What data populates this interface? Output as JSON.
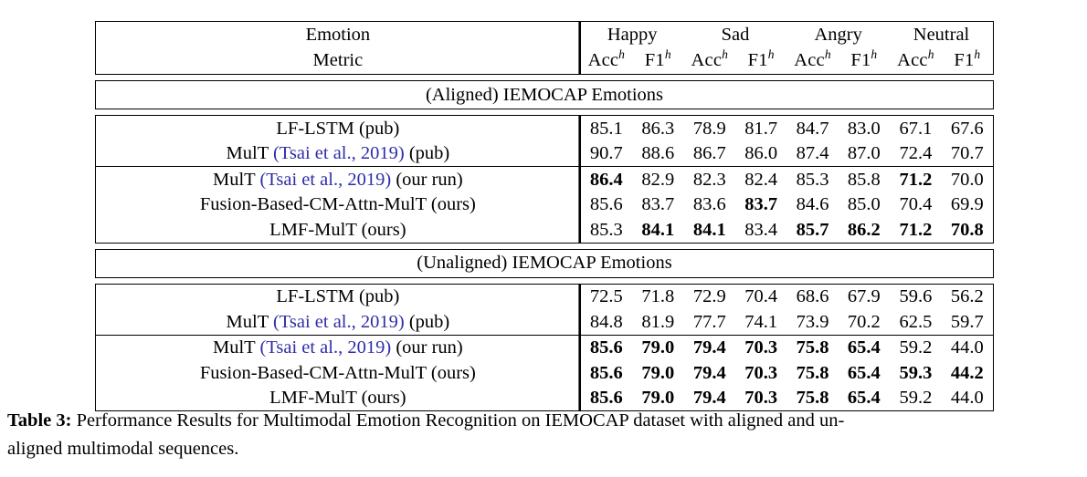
{
  "table": {
    "id_label": "Table 3:",
    "caption_line1": "Performance Results for Multimodal Emotion Recognition on IEMOCAP dataset with aligned and un-",
    "caption_line2": "aligned multimodal sequences.",
    "header": {
      "emotion_label": "Emotion",
      "metric_label": "Metric",
      "emotions": [
        "Happy",
        "Sad",
        "Angry",
        "Neutral"
      ],
      "metrics": [
        "Acc",
        "F1"
      ],
      "metric_superscript": "h"
    },
    "sections": [
      {
        "title": "(Aligned) IEMOCAP Emotions",
        "groups": [
          {
            "rows": [
              {
                "label_parts": [
                  {
                    "text": "LF-LSTM (pub)",
                    "cite": false
                  }
                ],
                "values": [
                  "85.1",
                  "86.3",
                  "78.9",
                  "81.7",
                  "84.7",
                  "83.0",
                  "67.1",
                  "67.6"
                ],
                "bold": [
                  false,
                  false,
                  false,
                  false,
                  false,
                  false,
                  false,
                  false
                ]
              },
              {
                "label_parts": [
                  {
                    "text": "MulT ",
                    "cite": false
                  },
                  {
                    "text": "(Tsai et al., 2019)",
                    "cite": true
                  },
                  {
                    "text": " (pub)",
                    "cite": false
                  }
                ],
                "values": [
                  "90.7",
                  "88.6",
                  "86.7",
                  "86.0",
                  "87.4",
                  "87.0",
                  "72.4",
                  "70.7"
                ],
                "bold": [
                  false,
                  false,
                  false,
                  false,
                  false,
                  false,
                  false,
                  false
                ]
              }
            ]
          },
          {
            "rows": [
              {
                "label_parts": [
                  {
                    "text": "MulT ",
                    "cite": false
                  },
                  {
                    "text": "(Tsai et al., 2019)",
                    "cite": true
                  },
                  {
                    "text": " (our run)",
                    "cite": false
                  }
                ],
                "values": [
                  "86.4",
                  "82.9",
                  "82.3",
                  "82.4",
                  "85.3",
                  "85.8",
                  "71.2",
                  "70.0"
                ],
                "bold": [
                  true,
                  false,
                  false,
                  false,
                  false,
                  false,
                  true,
                  false
                ]
              },
              {
                "label_parts": [
                  {
                    "text": "Fusion-Based-CM-Attn-MulT (ours)",
                    "cite": false
                  }
                ],
                "values": [
                  "85.6",
                  "83.7",
                  "83.6",
                  "83.7",
                  "84.6",
                  "85.0",
                  "70.4",
                  "69.9"
                ],
                "bold": [
                  false,
                  false,
                  false,
                  true,
                  false,
                  false,
                  false,
                  false
                ]
              },
              {
                "label_parts": [
                  {
                    "text": "LMF-MulT (ours)",
                    "cite": false
                  }
                ],
                "values": [
                  "85.3",
                  "84.1",
                  "84.1",
                  "83.4",
                  "85.7",
                  "86.2",
                  "71.2",
                  "70.8"
                ],
                "bold": [
                  false,
                  true,
                  true,
                  false,
                  true,
                  true,
                  true,
                  true
                ]
              }
            ]
          }
        ]
      },
      {
        "title": "(Unaligned) IEMOCAP Emotions",
        "groups": [
          {
            "rows": [
              {
                "label_parts": [
                  {
                    "text": "LF-LSTM (pub)",
                    "cite": false
                  }
                ],
                "values": [
                  "72.5",
                  "71.8",
                  "72.9",
                  "70.4",
                  "68.6",
                  "67.9",
                  "59.6",
                  "56.2"
                ],
                "bold": [
                  false,
                  false,
                  false,
                  false,
                  false,
                  false,
                  false,
                  false
                ]
              },
              {
                "label_parts": [
                  {
                    "text": "MulT ",
                    "cite": false
                  },
                  {
                    "text": "(Tsai et al., 2019)",
                    "cite": true
                  },
                  {
                    "text": " (pub)",
                    "cite": false
                  }
                ],
                "values": [
                  "84.8",
                  "81.9",
                  "77.7",
                  "74.1",
                  "73.9",
                  "70.2",
                  "62.5",
                  "59.7"
                ],
                "bold": [
                  false,
                  false,
                  false,
                  false,
                  false,
                  false,
                  false,
                  false
                ]
              }
            ]
          },
          {
            "rows": [
              {
                "label_parts": [
                  {
                    "text": "MulT ",
                    "cite": false
                  },
                  {
                    "text": "(Tsai et al., 2019)",
                    "cite": true
                  },
                  {
                    "text": " (our run)",
                    "cite": false
                  }
                ],
                "values": [
                  "85.6",
                  "79.0",
                  "79.4",
                  "70.3",
                  "75.8",
                  "65.4",
                  "59.2",
                  "44.0"
                ],
                "bold": [
                  true,
                  true,
                  true,
                  true,
                  true,
                  true,
                  false,
                  false
                ]
              },
              {
                "label_parts": [
                  {
                    "text": "Fusion-Based-CM-Attn-MulT (ours)",
                    "cite": false
                  }
                ],
                "values": [
                  "85.6",
                  "79.0",
                  "79.4",
                  "70.3",
                  "75.8",
                  "65.4",
                  "59.3",
                  "44.2"
                ],
                "bold": [
                  true,
                  true,
                  true,
                  true,
                  true,
                  true,
                  true,
                  true
                ]
              },
              {
                "label_parts": [
                  {
                    "text": "LMF-MulT (ours)",
                    "cite": false
                  }
                ],
                "values": [
                  "85.6",
                  "79.0",
                  "79.4",
                  "70.3",
                  "75.8",
                  "65.4",
                  "59.2",
                  "44.0"
                ],
                "bold": [
                  true,
                  true,
                  true,
                  true,
                  true,
                  true,
                  false,
                  false
                ]
              }
            ]
          }
        ]
      }
    ],
    "colors": {
      "citation_link": "#2e2ea8",
      "rule": "#000000",
      "text": "#000000"
    }
  }
}
